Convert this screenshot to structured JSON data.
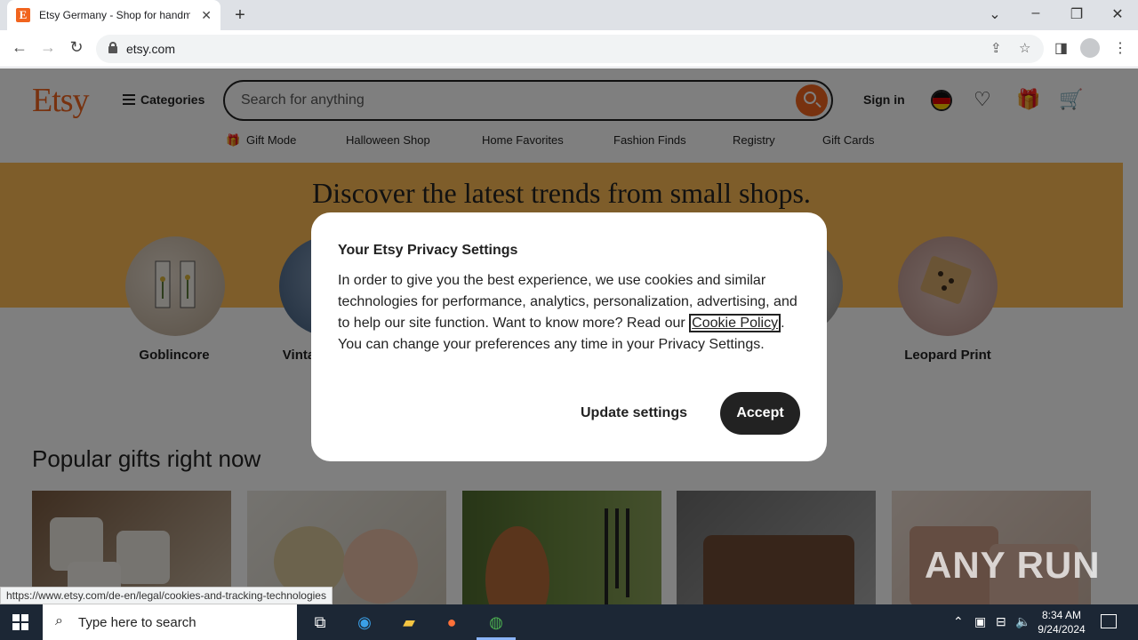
{
  "browser": {
    "tab_title": "Etsy Germany - Shop for handmade",
    "url": "etsy.com",
    "new_tab_symbol": "+",
    "close_symbol": "✕"
  },
  "header": {
    "logo": "Etsy",
    "categories": "Categories",
    "search_placeholder": "Search for anything",
    "sign_in": "Sign in"
  },
  "subnav": [
    "Gift Mode",
    "Halloween Shop",
    "Home Favorites",
    "Fashion Finds",
    "Registry",
    "Gift Cards"
  ],
  "banner": {
    "title": "Discover the latest trends from small shops.",
    "items": [
      "Goblincore",
      "Vinta",
      "Leopard Print"
    ]
  },
  "popular_title": "Popular gifts right now",
  "privacy_modal": {
    "title": "Your Etsy Privacy Settings",
    "body_before": "In order to give you the best experience, we use cookies and similar technologies for performance, analytics, personalization, advertising, and to help our site function. Want to know more? Read our ",
    "link": "Cookie Policy",
    "body_after": ". You can change your preferences any time in your Privacy Settings.",
    "update_button": "Update settings",
    "accept_button": "Accept"
  },
  "status_bar_url": "https://www.etsy.com/de-en/legal/cookies-and-tracking-technologies",
  "watermark": "ANY RUN",
  "taskbar": {
    "search_placeholder": "Type here to search",
    "time": "8:34 AM",
    "date": "9/24/2024"
  },
  "colors": {
    "etsy_orange": "#f1641e",
    "banner": "#fdba55",
    "accept_bg": "#222222"
  }
}
